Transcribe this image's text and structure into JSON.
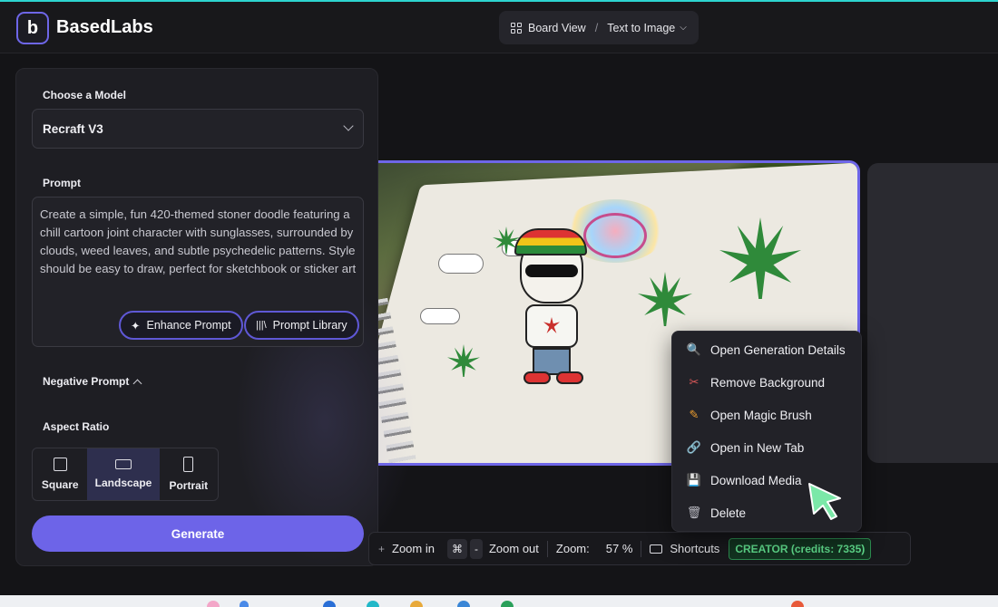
{
  "app": {
    "brand": "BasedLabs",
    "logo_letter": "b",
    "accent_color": "#6d64e8"
  },
  "breadcrumb": {
    "view_label": "Board View",
    "separator": "/",
    "mode_label": "Text to Image"
  },
  "panel": {
    "model_label": "Choose a Model",
    "model_value": "Recraft V3",
    "prompt_label": "Prompt",
    "prompt_text": "Create a simple, fun 420-themed stoner doodle featuring a chill cartoon joint character with sunglasses, surrounded by clouds, weed leaves, and subtle psychedelic patterns. Style should be easy to draw, perfect for sketchbook or sticker art",
    "enhance_label": "Enhance Prompt",
    "library_label": "Prompt Library",
    "negative_label": "Negative Prompt",
    "aspect_label": "Aspect Ratio",
    "aspect_options": [
      "Square",
      "Landscape",
      "Portrait"
    ],
    "aspect_selected": "Landscape",
    "generate_label": "Generate"
  },
  "context_menu": {
    "items": [
      {
        "label": "Open Generation Details",
        "icon": "magnifier-icon"
      },
      {
        "label": "Remove Background",
        "icon": "scissors-icon"
      },
      {
        "label": "Open Magic Brush",
        "icon": "pencil-icon"
      },
      {
        "label": "Open in New Tab",
        "icon": "link-icon"
      },
      {
        "label": "Download Media",
        "icon": "floppy-icon"
      },
      {
        "label": "Delete",
        "icon": "trash-icon"
      }
    ]
  },
  "toolbar": {
    "zoom_in": "Zoom in",
    "zoom_out_key_cmd": "⌘",
    "zoom_out_key": "-",
    "zoom_out": "Zoom out",
    "zoom_label": "Zoom:",
    "zoom_value": "57 %",
    "shortcuts": "Shortcuts",
    "credits": "CREATOR (credits: 7335)"
  }
}
